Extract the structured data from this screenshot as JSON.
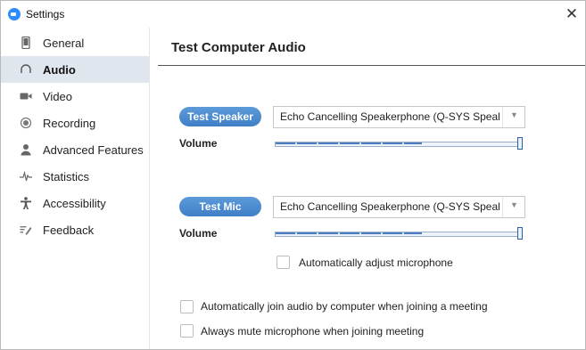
{
  "window": {
    "title": "Settings",
    "close_glyph": "✕"
  },
  "sidebar": {
    "items": [
      {
        "label": "General",
        "icon": "phone-icon"
      },
      {
        "label": "Audio",
        "icon": "headphones-icon",
        "active": true
      },
      {
        "label": "Video",
        "icon": "video-camera-icon"
      },
      {
        "label": "Recording",
        "icon": "record-icon"
      },
      {
        "label": "Advanced Features",
        "icon": "user-icon"
      },
      {
        "label": "Statistics",
        "icon": "pulse-icon"
      },
      {
        "label": "Accessibility",
        "icon": "accessibility-icon"
      },
      {
        "label": "Feedback",
        "icon": "feedback-icon"
      }
    ]
  },
  "main": {
    "title": "Test Computer Audio",
    "speaker": {
      "button_label": "Test Speaker",
      "device": "Echo Cancelling Speakerphone (Q-SYS Speake",
      "volume_label": "Volume",
      "volume_level": 0.6
    },
    "mic": {
      "button_label": "Test Mic",
      "device": "Echo Cancelling Speakerphone (Q-SYS Speake",
      "volume_label": "Volume",
      "volume_level": 0.6
    },
    "auto_adjust_label": "Automatically adjust microphone",
    "options": [
      "Automatically join audio by computer when joining a meeting",
      "Always mute microphone when joining meeting"
    ]
  },
  "colors": {
    "accent": "#4f8ed1",
    "active_bg": "#e0e6ee"
  }
}
